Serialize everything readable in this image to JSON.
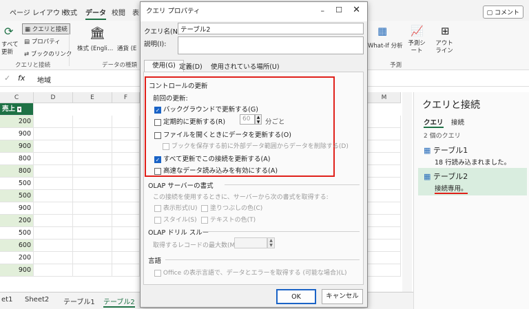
{
  "ribbon": {
    "tabs": [
      "ページ レイアウト",
      "数式",
      "データ",
      "校閲",
      "表"
    ],
    "comment": "コメント",
    "refresh_all": "すべて更新",
    "queries_connections": "クエリと接続",
    "properties": "プロパティ",
    "edit_links": "ブックのリンク",
    "group_queries": "クエリと接続",
    "stocks": "株式 (Engli…",
    "currencies": "通貨 (E",
    "group_datatypes": "データの種類",
    "whatif": "What-If 分析",
    "forecast_sheet": "予測シート",
    "outline": "アウトライン",
    "group_forecast": "予測"
  },
  "formula": {
    "fx": "fx",
    "value": "地域"
  },
  "grid": {
    "columns": [
      "C",
      "D",
      "E",
      "F",
      "M"
    ],
    "c_header": "売上",
    "values": [
      "200",
      "900",
      "900",
      "800",
      "800",
      "500",
      "500",
      "900",
      "200",
      "500",
      "600",
      "200",
      "900"
    ]
  },
  "sheets": [
    "et1",
    "Sheet2",
    "テーブル1",
    "テーブル2"
  ],
  "pane": {
    "title": "クエリと接続",
    "tab_query": "クエリ",
    "tab_conn": "接続",
    "count": "2 個のクエリ",
    "items": [
      {
        "name": "テーブル1",
        "status": "18 行読み込まれました。"
      },
      {
        "name": "テーブル2",
        "status": "接続専用。"
      }
    ]
  },
  "dialog": {
    "title": "クエリ プロパティ",
    "name_label": "クエリ名(N):",
    "name_value": "テーブル2",
    "desc_label": "説明(I):",
    "tabs": [
      "使用(G)",
      "定義(D)",
      "使用されている場所(U)"
    ],
    "refresh_section": "コントロールの更新",
    "last_refresh": "前回の更新:",
    "bg_refresh": "バックグラウンドで更新する(G)",
    "periodic": "定期的に更新する(R)",
    "minutes_value": "60",
    "minutes_unit": "分ごと",
    "on_open": "ファイルを開くときにデータを更新する(O)",
    "remove_data": "ブックを保存する前に外部データ範囲からデータを削除する(D)",
    "refresh_all": "すべて更新でこの接続を更新する(A)",
    "fast_load": "高速なデータ読み込みを有効にする(A)",
    "olap_format": "OLAP サーバーの書式",
    "olap_desc": "この接続を使用するときに、サーバーから次の書式を取得する:",
    "number_format": "表示形式(U)",
    "fill_color": "塗りつぶしの色(C)",
    "style": "スタイル(S)",
    "text_color": "テキストの色(T)",
    "drill": "OLAP ドリル スルー",
    "max_records": "取得するレコードの最大数(M):",
    "language": "言語",
    "lang_opt": "Office の表示言語で、データとエラーを取得する (可能な場合)(L)",
    "ok": "OK",
    "cancel": "キャンセル"
  }
}
